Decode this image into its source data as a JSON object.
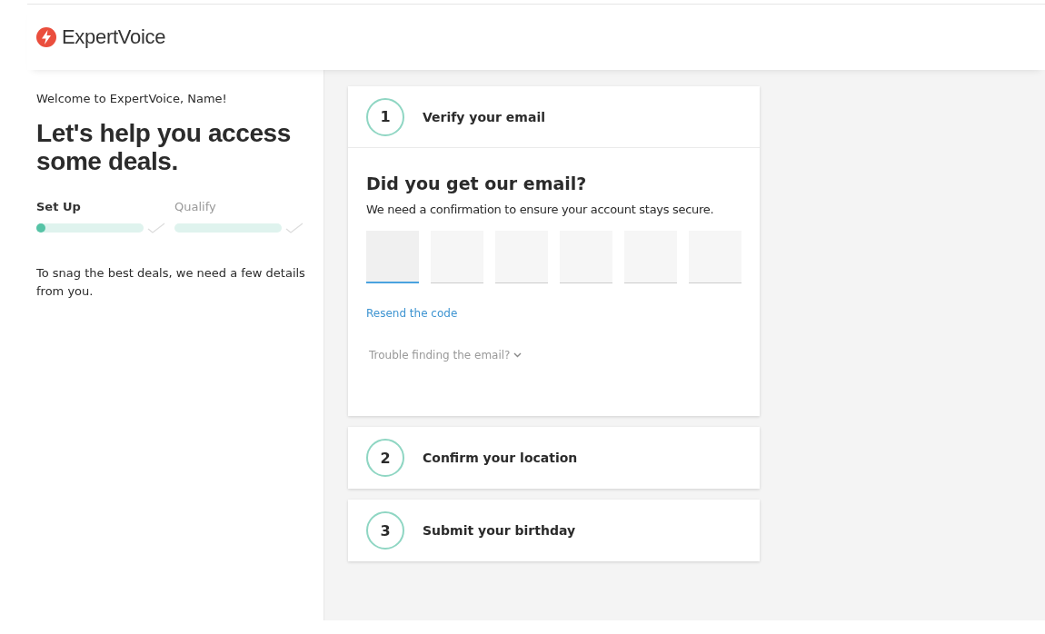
{
  "header": {
    "brand": "ExpertVoice"
  },
  "sidebar": {
    "welcome": "Welcome to ExpertVoice, Name!",
    "heading": "Let's help you access some deals.",
    "progress": [
      {
        "label": "Set Up",
        "selected": true,
        "level": 0.03,
        "done": false
      },
      {
        "label": "Qualify",
        "selected": false,
        "done": false
      }
    ],
    "note": "To snag the best deals, we need a few details from you."
  },
  "steps": [
    {
      "number": "1",
      "title": "Verify your email",
      "expanded": true
    },
    {
      "number": "2",
      "title": "Confirm your location",
      "expanded": false
    },
    {
      "number": "3",
      "title": "Submit your birthday",
      "expanded": false
    }
  ],
  "verify": {
    "heading": "Did you get our email?",
    "text": "We need a confirmation to ensure your account stays secure.",
    "code_digits": [
      {
        "focused": true
      },
      {
        "focused": false
      },
      {
        "focused": false
      },
      {
        "focused": false
      },
      {
        "focused": false
      },
      {
        "focused": false
      }
    ],
    "resend_link": "Resend the code",
    "help_toggle": "Trouble finding the email?",
    "help_expanded": false
  }
}
